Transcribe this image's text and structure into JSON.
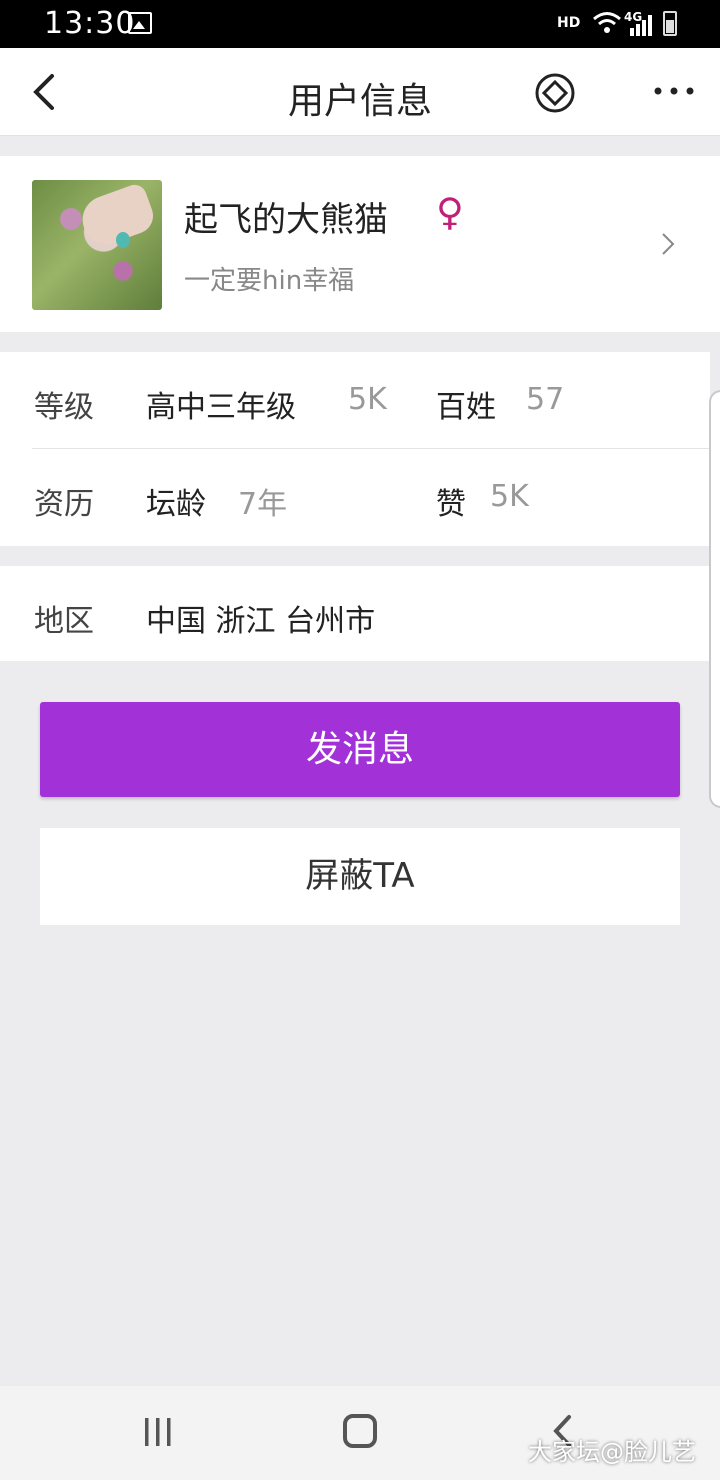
{
  "status": {
    "time": "13:30",
    "hd": "HD",
    "network": "4G"
  },
  "nav": {
    "title": "用户信息"
  },
  "profile": {
    "name": "起飞的大熊猫",
    "gender_symbol": "♀",
    "signature": "一定要hin幸福"
  },
  "info": {
    "level_label": "等级",
    "level_value": "高中三年级",
    "level_num": "5K",
    "baixing_label": "百姓",
    "baixing_num": "57",
    "history_label": "资历",
    "tan_label": "坛龄",
    "tan_value": "7年",
    "zan_label": "赞",
    "zan_num": "5K",
    "region_label": "地区",
    "region_value": "中国 浙江 台州市"
  },
  "buttons": {
    "message": "发消息",
    "block": "屏蔽TA"
  },
  "watermark": "大家坛@脸儿艺",
  "colors": {
    "accent": "#a232d8",
    "gender": "#c21f7a"
  }
}
